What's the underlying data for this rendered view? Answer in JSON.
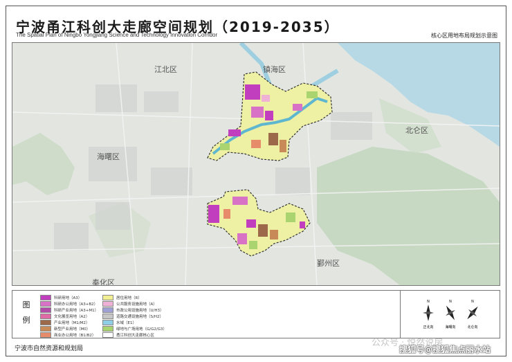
{
  "header": {
    "title_cn": "宁波甬江科创大走廊空间规划（2019-2035）",
    "title_en": "The Spatial Plan of Ningbo Yongjiang Science and Technology Innovation Corridor",
    "subtitle": "核心区用地布局规划示意图"
  },
  "map": {
    "district_labels": [
      "江北区",
      "镇海区",
      "北仑区",
      "海曙区",
      "奉化区",
      "鄞州区"
    ]
  },
  "legend": {
    "title": "图例",
    "items_left": [
      {
        "label": "科研用地（A3）",
        "color": "#c13fbf"
      },
      {
        "label": "科研办公用地（A3+B2）",
        "color": "#d872c7"
      },
      {
        "label": "科研产业用地（A3+M1）",
        "color": "#b24ca8"
      },
      {
        "label": "文化展览用地（A2）",
        "color": "#e06aa6"
      },
      {
        "label": "产业用地（M1/M2）",
        "color": "#9c6a4a"
      },
      {
        "label": "新型产业用地（M0）",
        "color": "#c88a56"
      },
      {
        "label": "商业办公用地（B1/B2）",
        "color": "#e78c6a"
      }
    ],
    "items_right": [
      {
        "label": "居住用地（R）",
        "color": "#f2ee93"
      },
      {
        "label": "公共服务设施用地（A）",
        "color": "#f0b1d6"
      },
      {
        "label": "市政公用设施用地（U/H3）",
        "color": "#9fa1d4"
      },
      {
        "label": "道路交通设施用地（S/H2）",
        "color": "#c7c7c7"
      },
      {
        "label": "水域（E1）",
        "color": "#8fcfe6"
      },
      {
        "label": "绿地与广场用地（G/G2/G3）",
        "color": "#a9d46f"
      },
      {
        "label": "甬江科创大走廊核心区",
        "color": "#ffffff"
      }
    ],
    "compass_labels": [
      "正北向",
      "海曙向",
      "北仑向"
    ]
  },
  "footer": {
    "agency": "宁波市自然资源和规划局",
    "watermark_faint": "公众号 · 悦然说房",
    "watermark": "搜狐号@搜狐焦点丽水站"
  },
  "colors": {
    "water": "#5fb7cf",
    "research": "#c13fbf",
    "residential": "#f2ee93",
    "green": "#a9d46f",
    "industrial": "#9c6a4a",
    "boundary": "#333333"
  }
}
